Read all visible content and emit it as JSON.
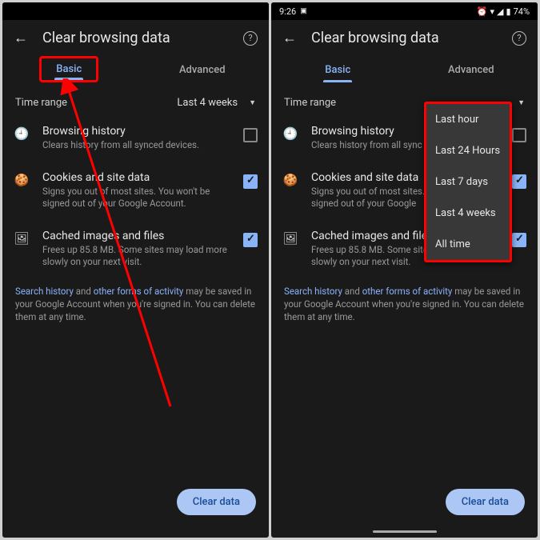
{
  "status": {
    "time": "9:26",
    "battery": "74%"
  },
  "title": "Clear browsing data",
  "tabs": {
    "basic": "Basic",
    "advanced": "Advanced"
  },
  "range": {
    "label": "Time range",
    "value": "Last 4 weeks"
  },
  "items": {
    "history": {
      "title": "Browsing history",
      "sub": "Clears history from all synced devices."
    },
    "cookies": {
      "title": "Cookies and site data",
      "sub": "Signs you out of most sites. You won't be signed out of your Google Account."
    },
    "cookies_clipped": {
      "sub": "Signs you out of most sites. You won't be signed out of your Google"
    },
    "history_clipped": {
      "sub": "Clears history from all sync"
    },
    "cache": {
      "title": "Cached images and files",
      "sub": "Frees up 85.8 MB. Some sites may load more slowly on your next visit."
    },
    "cache_clipped": {
      "title": "Cached images and files"
    }
  },
  "footnote": {
    "l1": "Search history",
    "mid": " and ",
    "l2": "other forms of activity",
    "rest": " may be saved in your Google Account when you're signed in. You can delete them at any time."
  },
  "button": "Clear data",
  "dropdown": [
    "Last hour",
    "Last 24 Hours",
    "Last 7 days",
    "Last 4 weeks",
    "All time"
  ]
}
